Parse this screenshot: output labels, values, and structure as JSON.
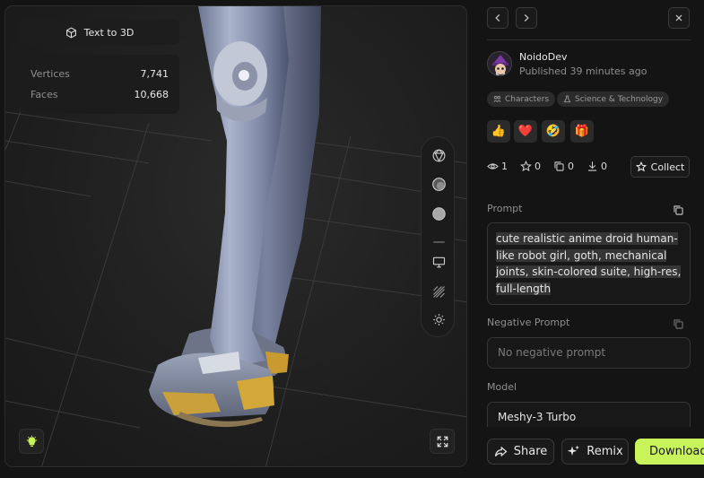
{
  "viewer": {
    "mode_label": "Text to 3D",
    "stats": [
      {
        "label": "Vertices",
        "value": "7,741"
      },
      {
        "label": "Faces",
        "value": "10,668"
      }
    ]
  },
  "author": {
    "name": "NoidoDev",
    "published": "Published 39 minutes ago"
  },
  "tags": [
    "Characters",
    "Science & Technology"
  ],
  "reactions": [
    "👍",
    "❤️",
    "🤣",
    "🎁"
  ],
  "counts": {
    "views": "1",
    "likes": "0",
    "copies": "0",
    "downloads": "0"
  },
  "collect_label": "Collect",
  "prompt": {
    "label": "Prompt",
    "lines": [
      "cute realistic anime droid human-",
      "like robot girl, goth, mechanical",
      "joints, skin-colored suite, high-res,",
      "full-length"
    ]
  },
  "negative_prompt": {
    "label": "Negative Prompt",
    "placeholder": "No negative prompt"
  },
  "model": {
    "label": "Model",
    "value": "Meshy-3 Turbo"
  },
  "actions": {
    "share": "Share",
    "remix": "Remix",
    "download": "Download"
  },
  "colors": {
    "accent": "#c9f35a",
    "background": "#141414",
    "surface": "#1b1b1b"
  }
}
